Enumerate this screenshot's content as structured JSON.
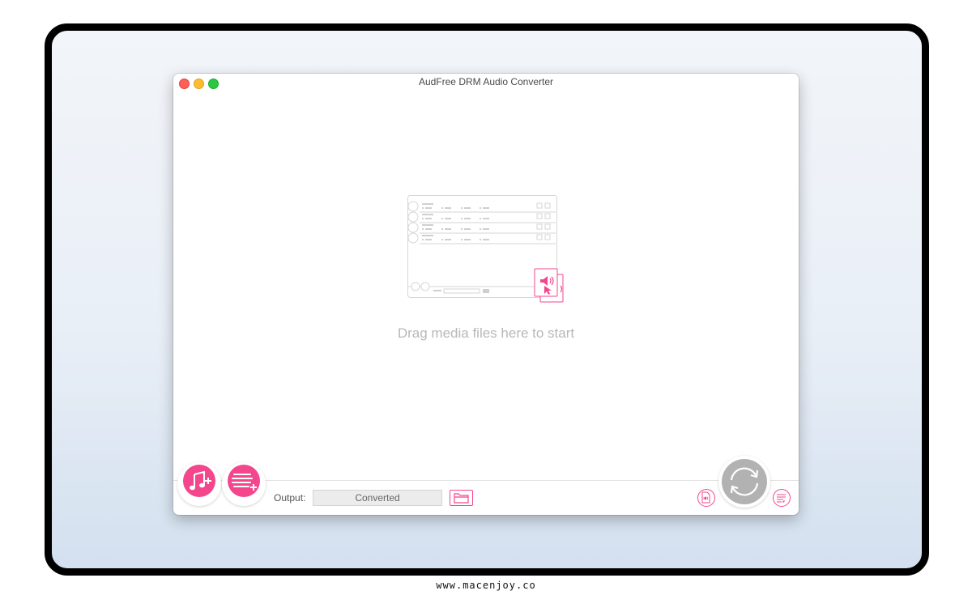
{
  "window": {
    "title": "AudFree DRM Audio Converter"
  },
  "main": {
    "drop_hint": "Drag media files here to start"
  },
  "bottom_bar": {
    "output_label": "Output:",
    "output_value": "Converted"
  },
  "icons": {
    "add_music": "music-note-plus-icon",
    "add_playlist": "list-plus-icon",
    "browse": "folder-icon",
    "audio_editor": "audio-file-icon",
    "format": "format-settings-icon",
    "convert": "convert-arrows-icon"
  },
  "colors": {
    "accent": "#f3468c",
    "convert_disabled": "#b2b2b2",
    "text_hint": "#b8b8b8"
  },
  "footer": {
    "watermark": "www.macenjoy.co"
  }
}
